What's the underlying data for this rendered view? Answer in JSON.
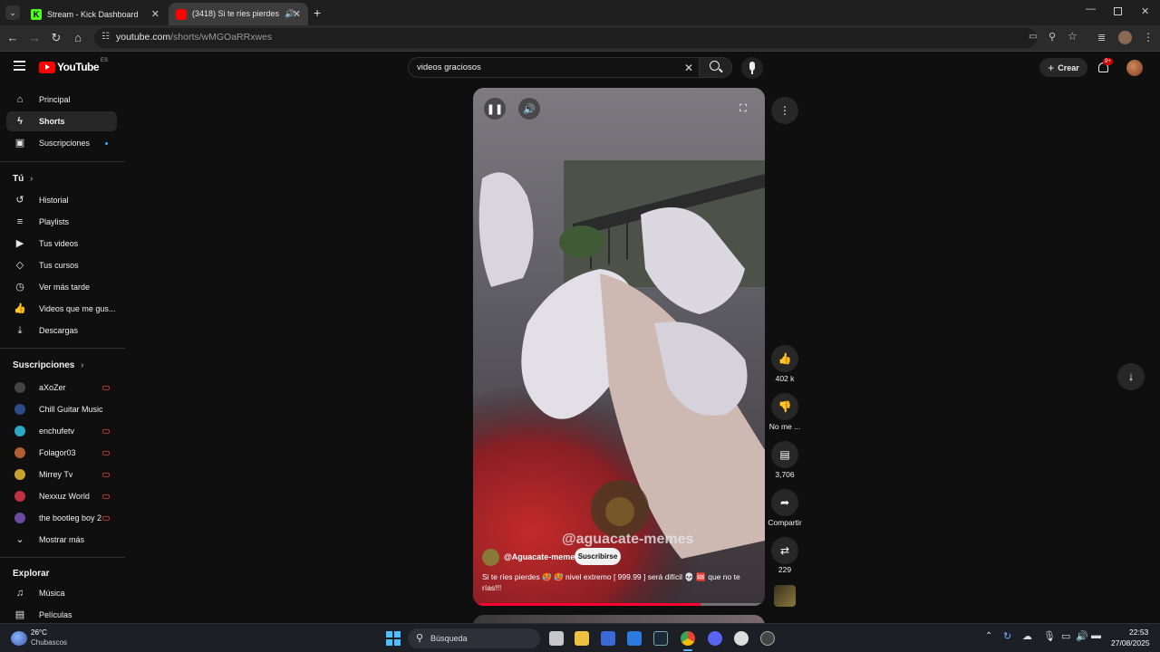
{
  "browser": {
    "tabs": [
      {
        "title": "Stream - Kick Dashboard"
      },
      {
        "title": "(3418) Si te ríes pierdes 🥵 I"
      }
    ],
    "url_host": "youtube.com",
    "url_path": "/shorts/wMGOaRRxwes"
  },
  "header": {
    "logo_text": "YouTube",
    "region": "ES",
    "search_value": "videos graciosos",
    "create_label": "Crear",
    "notif_count": "9+"
  },
  "sidebar": {
    "main": [
      {
        "label": "Principal"
      },
      {
        "label": "Shorts"
      },
      {
        "label": "Suscripciones"
      }
    ],
    "you_title": "Tú",
    "you": [
      {
        "label": "Historial"
      },
      {
        "label": "Playlists"
      },
      {
        "label": "Tus videos"
      },
      {
        "label": "Tus cursos"
      },
      {
        "label": "Ver más tarde"
      },
      {
        "label": "Videos que me gus..."
      },
      {
        "label": "Descargas"
      }
    ],
    "subs_title": "Suscripciones",
    "subs": [
      {
        "label": "aXoZer"
      },
      {
        "label": "Chill Guitar Music"
      },
      {
        "label": "enchufetv"
      },
      {
        "label": "Folagor03"
      },
      {
        "label": "Mirrey Tv"
      },
      {
        "label": "Nexxuz World"
      },
      {
        "label": "the bootleg boy 2"
      }
    ],
    "more_label": "Mostrar más",
    "explore_title": "Explorar",
    "explore": [
      {
        "label": "Música"
      },
      {
        "label": "Películas"
      }
    ]
  },
  "short": {
    "watermark": "@aguacate-memes",
    "channel": "@Aguacate-memes",
    "subscribe_label": "Suscribirse",
    "caption": "Si te ríes pierdes 🥵 🥵 nivel extremo [ 999.99 ] será difícil 💀 🆘 que no te rías!!!",
    "progress": 0.78
  },
  "actions": {
    "likes": "402 k",
    "dislike": "No me ...",
    "comments": "3,706",
    "share": "Compartir",
    "remix": "229"
  },
  "taskbar": {
    "weather_temp": "26°C",
    "weather_desc": "Chubascos",
    "search_label": "Búsqueda",
    "time": "22:53",
    "date": "27/08/2025"
  }
}
